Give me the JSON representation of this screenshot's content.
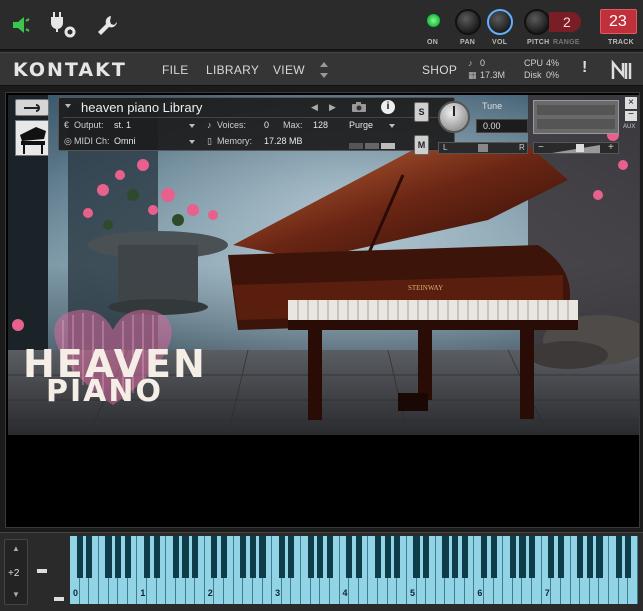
{
  "rack_header": {
    "on_label": "ON",
    "pan_label": "PAN",
    "vol_label": "VOL",
    "pitch_label": "PITCH",
    "range_label": "RANGE",
    "range_value": "2",
    "track_label": "TRACK",
    "track_value": "23"
  },
  "menu": {
    "logo": "KONTAKT",
    "file": "FILE",
    "library": "LIBRARY",
    "view": "VIEW",
    "shop": "SHOP",
    "voices_count": "0",
    "memory_total": "17.3M",
    "cpu_label": "CPU",
    "cpu_value": "4%",
    "disk_label": "Disk",
    "disk_value": "0%",
    "warning": "!"
  },
  "instrument": {
    "name": "heaven piano Library",
    "output_label": "Output:",
    "output_value": "st. 1",
    "voices_label": "Voices:",
    "voices_value": "0",
    "max_label": "Max:",
    "max_value": "128",
    "purge_label": "Purge",
    "midi_label": "MIDI Ch:",
    "midi_value": "Omni",
    "memory_label": "Memory:",
    "memory_value": "17.28 MB",
    "solo_label": "S",
    "mute_label": "M",
    "tune_label": "Tune",
    "tune_value": "0.00",
    "pan_left": "L",
    "pan_right": "R",
    "aux_label": "AUX"
  },
  "artwork": {
    "title_line1": "HEAVEN",
    "title_line2": "PIANO",
    "piano_brand": "STEINWAY"
  },
  "keyboard": {
    "transpose_value": "+2",
    "octave_labels": [
      "0",
      "1",
      "2",
      "3",
      "4",
      "5",
      "6",
      "7"
    ]
  },
  "colors": {
    "accent_blue": "#5fb0ff",
    "track_red": "#c0303a",
    "key_white": "#93d3e6",
    "key_black": "#0e3c48",
    "power_green": "#39c64a"
  }
}
